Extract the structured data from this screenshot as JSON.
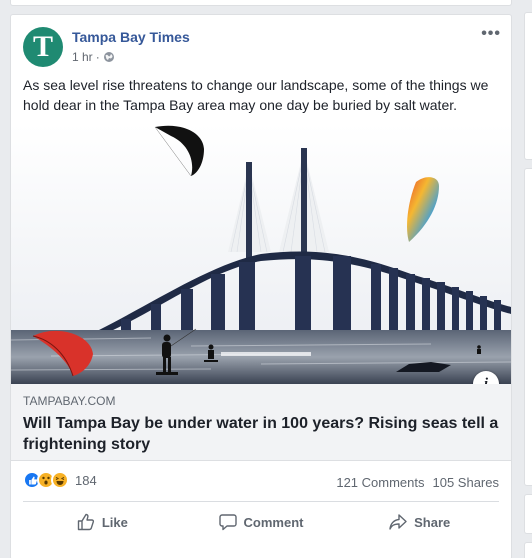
{
  "post": {
    "page_name": "Tampa Bay Times",
    "avatar_letter": "T",
    "time": "1 hr",
    "privacy_icon": "globe-icon",
    "more_icon": "more-options-icon",
    "text": "As sea level rise threatens to change our landscape, some of the things we hold dear in the Tampa Bay area may one day be buried by salt water."
  },
  "link": {
    "domain": "TAMPABAY.COM",
    "title": "Will Tampa Bay be under water in 100 years? Rising seas tell a frightening story",
    "info_label": "i"
  },
  "stats": {
    "reaction_icons": [
      "like-reaction-icon",
      "wow-reaction-icon",
      "haha-reaction-icon"
    ],
    "reaction_count": "184",
    "comments": "121 Comments",
    "shares": "105 Shares"
  },
  "actions": {
    "like": "Like",
    "comment": "Comment",
    "share": "Share"
  },
  "colors": {
    "brand_link": "#365899",
    "avatar_bg": "#1f8a72",
    "sky": "#f4f6f9",
    "bridge": "#1f2a45"
  }
}
